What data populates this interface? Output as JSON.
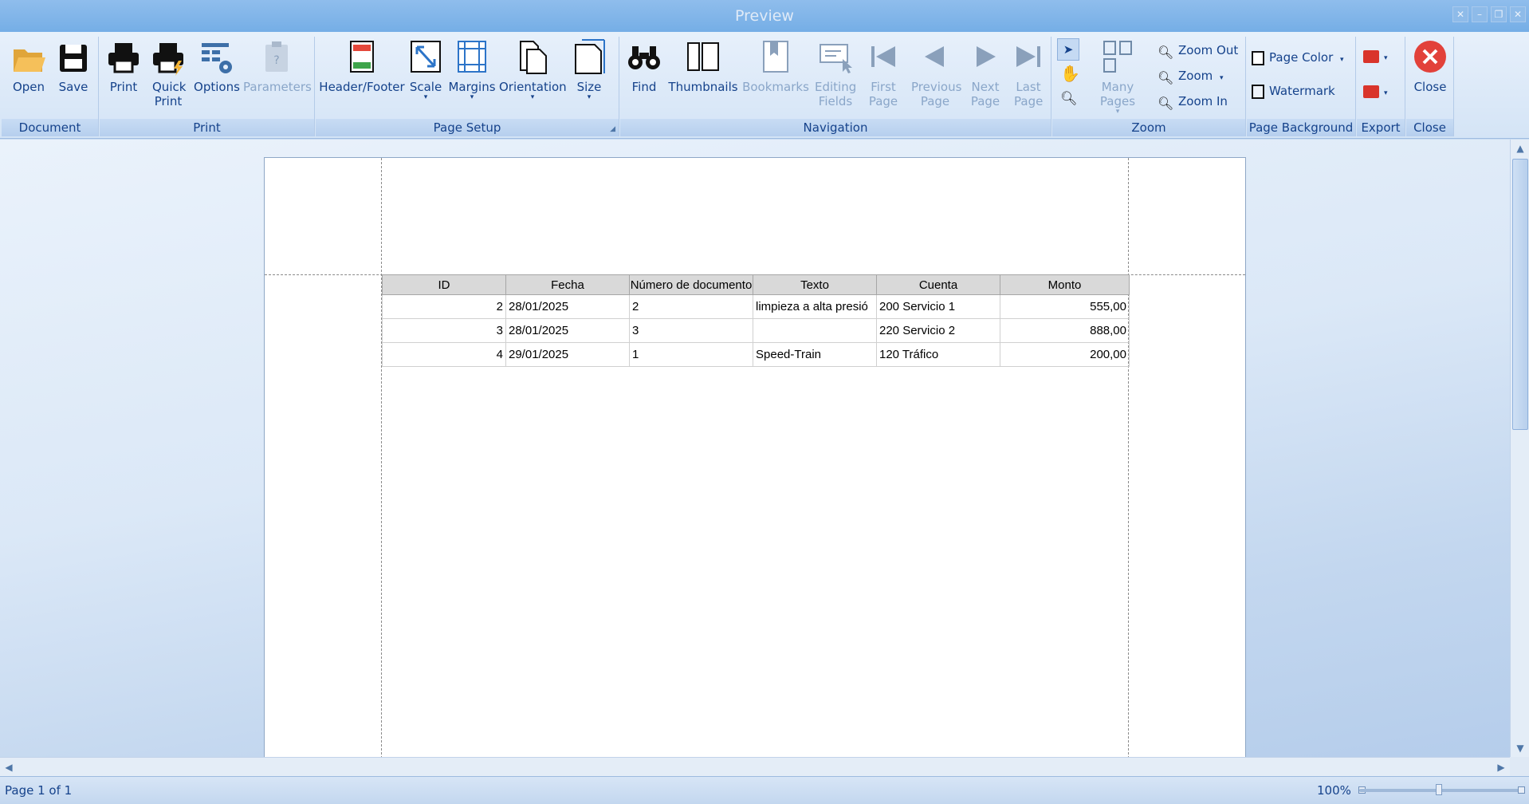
{
  "window": {
    "title": "Preview"
  },
  "ribbon": {
    "groups": {
      "document": "Document",
      "print": "Print",
      "page_setup": "Page Setup",
      "navigation": "Navigation",
      "zoom": "Zoom",
      "page_background": "Page Background",
      "export": "Export",
      "close": "Close"
    },
    "buttons": {
      "open": "Open",
      "save": "Save",
      "print": "Print",
      "quick_print": "Quick Print",
      "options": "Options",
      "parameters": "Parameters",
      "header_footer": "Header/Footer",
      "scale": "Scale",
      "margins": "Margins",
      "orientation": "Orientation",
      "size": "Size",
      "find": "Find",
      "thumbnails": "Thumbnails",
      "bookmarks": "Bookmarks",
      "editing_fields": "Editing Fields",
      "first_page": "First Page",
      "previous_page": "Previous Page",
      "next_page": "Next Page",
      "last_page": "Last Page",
      "many_pages": "Many Pages",
      "zoom_out": "Zoom Out",
      "zoom": "Zoom",
      "zoom_in": "Zoom In",
      "page_color": "Page Color",
      "watermark": "Watermark",
      "close": "Close"
    }
  },
  "report": {
    "columns": [
      "ID",
      "Fecha",
      "Número de documento",
      "Texto",
      "Cuenta",
      "Monto"
    ],
    "rows": [
      [
        "2",
        "28/01/2025",
        "2",
        "limpieza a alta presió",
        "200 Servicio 1",
        "555,00"
      ],
      [
        "3",
        "28/01/2025",
        "3",
        "",
        "220 Servicio 2",
        "888,00"
      ],
      [
        "4",
        "29/01/2025",
        "1",
        "Speed-Train",
        "120 Tráfico",
        "200,00"
      ]
    ]
  },
  "status": {
    "page": "Page 1 of 1",
    "zoom": "100%"
  }
}
